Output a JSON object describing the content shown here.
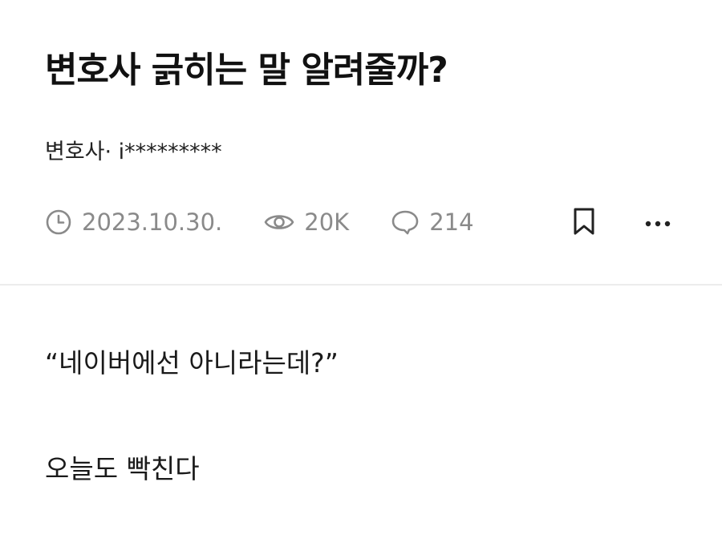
{
  "post": {
    "title": "변호사 긁히는 말 알려줄까?",
    "author_line": "변호사· i*********",
    "meta": {
      "date": "2023.10.30.",
      "views": "20K",
      "comments": "214"
    },
    "body_lines": [
      "“네이버에선 아니라는데?”",
      "오늘도 빡친다"
    ]
  },
  "icons": {
    "date": "clock-icon",
    "views": "eye-icon",
    "comments": "comment-bubble-icon",
    "bookmark": "bookmark-icon",
    "more": "more-dots-icon"
  },
  "colors": {
    "text": "#111111",
    "meta": "#8a8a8a",
    "divider": "#ececec",
    "background": "#ffffff"
  }
}
